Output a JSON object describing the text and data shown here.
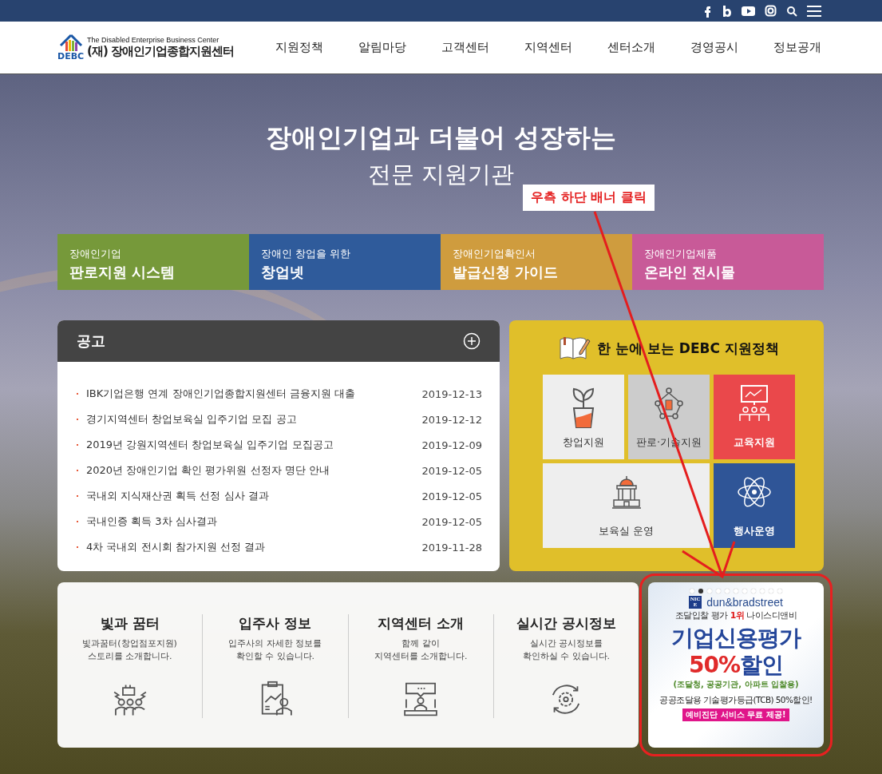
{
  "header": {
    "logo": {
      "mark": "DEBC",
      "english": "The Disabled Enterprise Business Center",
      "korean": "(재) 장애인기업종합지원센터"
    },
    "nav": [
      "지원정책",
      "알림마당",
      "고객센터",
      "지역센터",
      "센터소개",
      "경영공시",
      "정보공개"
    ]
  },
  "hero": {
    "title": "장애인기업과 더불어 성장하는",
    "subtitle": "전문 지원기관"
  },
  "quick_links": [
    {
      "caption": "장애인기업",
      "title": "판로지원 시스템",
      "color": "#76993a"
    },
    {
      "caption": "장애인 창업을 위한",
      "title": "창업넷",
      "color": "#2f5b9b"
    },
    {
      "caption": "장애인기업확인서",
      "title": "발급신청 가이드",
      "color": "#cf9c3e"
    },
    {
      "caption": "장애인기업제품",
      "title": "온라인 전시물",
      "color": "#c85a98"
    }
  ],
  "notices": {
    "title": "공고",
    "items": [
      {
        "title": "IBK기업은행 연계 장애인기업종합지원센터 금융지원 대출",
        "date": "2019-12-13"
      },
      {
        "title": "경기지역센터 창업보육실 입주기업 모집 공고",
        "date": "2019-12-12"
      },
      {
        "title": "2019년 강원지역센터 창업보육실 입주기업 모집공고",
        "date": "2019-12-09"
      },
      {
        "title": "2020년 장애인기업 확인 평가위원 선정자 명단 안내",
        "date": "2019-12-05"
      },
      {
        "title": "국내외 지식재산권 획득 선정 심사 결과",
        "date": "2019-12-05"
      },
      {
        "title": "국내인증 획득 3차 심사결과",
        "date": "2019-12-05"
      },
      {
        "title": "4차 국내외 전시회 참가지원 선정 결과",
        "date": "2019-11-28"
      }
    ]
  },
  "policy": {
    "title": "한 눈에 보는 DEBC 지원정책",
    "tiles": [
      {
        "label": "창업지원",
        "kind": "plant",
        "color": "#eeeeee",
        "wide": false
      },
      {
        "label": "판로·기술지원",
        "kind": "network",
        "color": "#cccccc",
        "wide": false
      },
      {
        "label": "교육지원",
        "kind": "lecture",
        "color": "#ea484b",
        "wide": false
      },
      {
        "label": "보육실 운영",
        "kind": "building",
        "color": "#eeeeee",
        "wide": true
      },
      {
        "label": "행사운영",
        "kind": "atom",
        "color": "#2f5597",
        "wide": false
      }
    ]
  },
  "services": [
    {
      "title": "빛과 꿈터",
      "description": "빛과꿈터(창업점포지원)\n스토리를 소개합니다.",
      "kind": "fist"
    },
    {
      "title": "입주사 정보",
      "description": "입주사의 자세한 정보를\n확인할 수 있습니다.",
      "kind": "clipboard"
    },
    {
      "title": "지역센터 소개",
      "description": "함께 같이\n지역센터를 소개합니다.",
      "kind": "meeting"
    },
    {
      "title": "실시간 공시정보",
      "description": "실시간 공시정보를\n확인하실 수 있습니다.",
      "kind": "gear"
    }
  ],
  "banner": {
    "dots": [
      {
        "selected": false
      },
      {
        "selected": true
      },
      {
        "selected": false
      },
      {
        "selected": false
      },
      {
        "selected": false
      },
      {
        "selected": false
      },
      {
        "selected": false
      },
      {
        "selected": false
      },
      {
        "selected": false
      },
      {
        "selected": false
      },
      {
        "selected": false
      }
    ],
    "logo": "NICE",
    "brand": "dun&bradstreet",
    "tagline": "조달입찰 평가 **1위** 나이스디앤비",
    "headline": "기업신용평가",
    "discount_number": "50%",
    "discount_word": "할인",
    "note": "(조달청, 공공기관, 아파트 입찰용)",
    "detail": "공공조달용 기술평가등급(TCB) 50%할인!",
    "highlight": "예비진단 서비스 무료 제공!"
  },
  "annotation": {
    "callout": "우측 하단 배너 클릭"
  }
}
